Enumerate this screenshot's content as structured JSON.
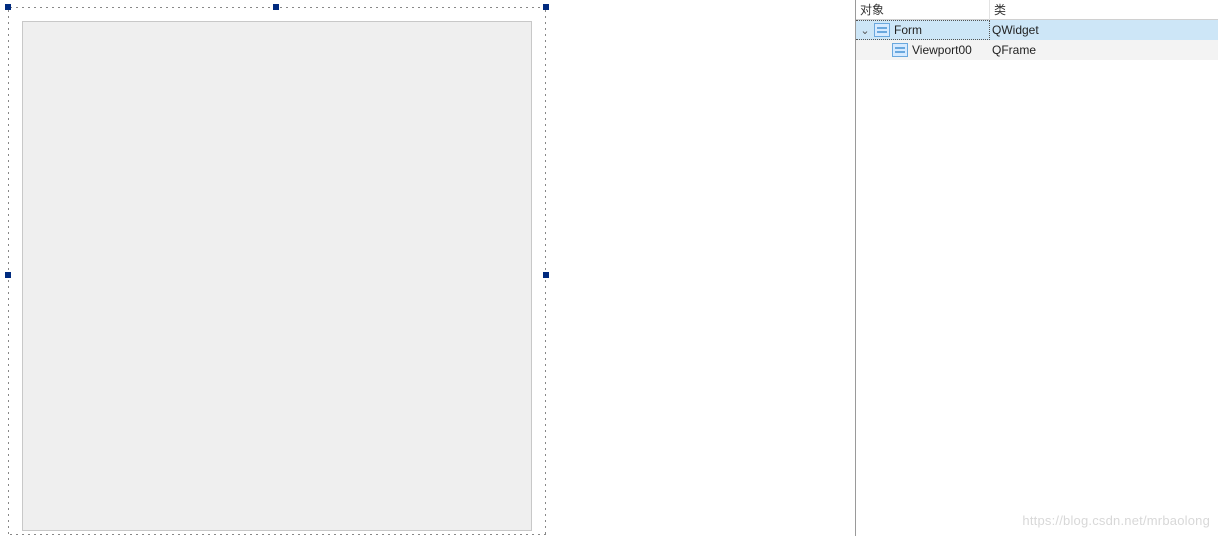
{
  "inspector": {
    "headers": {
      "object": "对象",
      "class": "类"
    },
    "rows": [
      {
        "name": "Form",
        "class": "QWidget",
        "indent": 0,
        "expanded": true,
        "selected": true,
        "hasChildren": true
      },
      {
        "name": "Viewport00",
        "class": "QFrame",
        "indent": 1,
        "expanded": false,
        "selected": false,
        "hasChildren": false
      }
    ]
  },
  "watermark": "https://blog.csdn.net/mrbaolong"
}
